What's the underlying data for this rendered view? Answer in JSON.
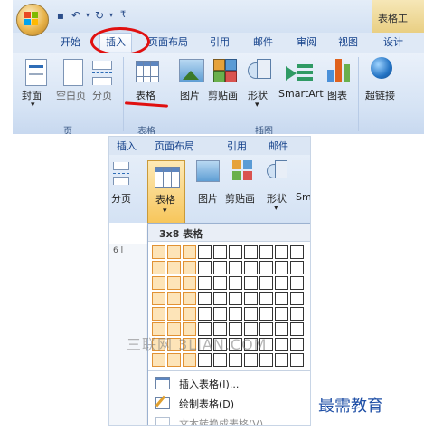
{
  "top_ribbon": {
    "context_tab": "表格工",
    "tabs": [
      "开始",
      "插入",
      "页面布局",
      "引用",
      "邮件",
      "审阅",
      "视图",
      "设计"
    ],
    "active_tab": "插入",
    "buttons": [
      "封面",
      "空白页",
      "分页",
      "表格",
      "图片",
      "剪贴画",
      "形状",
      "SmartArt",
      "图表",
      "超链接"
    ],
    "groups": [
      "页",
      "表格",
      "插图"
    ]
  },
  "second_ribbon": {
    "tabs": [
      "插入",
      "页面布局",
      "引用",
      "邮件"
    ],
    "buttons": [
      "分页",
      "表格",
      "图片",
      "剪贴画",
      "形状",
      "Sm"
    ]
  },
  "dropdown": {
    "title": "3x8 表格",
    "grid_cols": 10,
    "grid_rows": 8,
    "selected_cols": 3,
    "selected_rows": 8,
    "menu_items": [
      "插入表格(I)...",
      "绘制表格(D)",
      "文本转换成表格(V)..."
    ]
  },
  "ruler_mark": "6 l",
  "watermark": "三联网 3LIAN.COM",
  "brand": "最需教育",
  "colors": {
    "highlight": "#e01010",
    "grid_selected": "#fde4b8",
    "grid_selected_border": "#e19234",
    "brand": "#1f4fa6"
  }
}
